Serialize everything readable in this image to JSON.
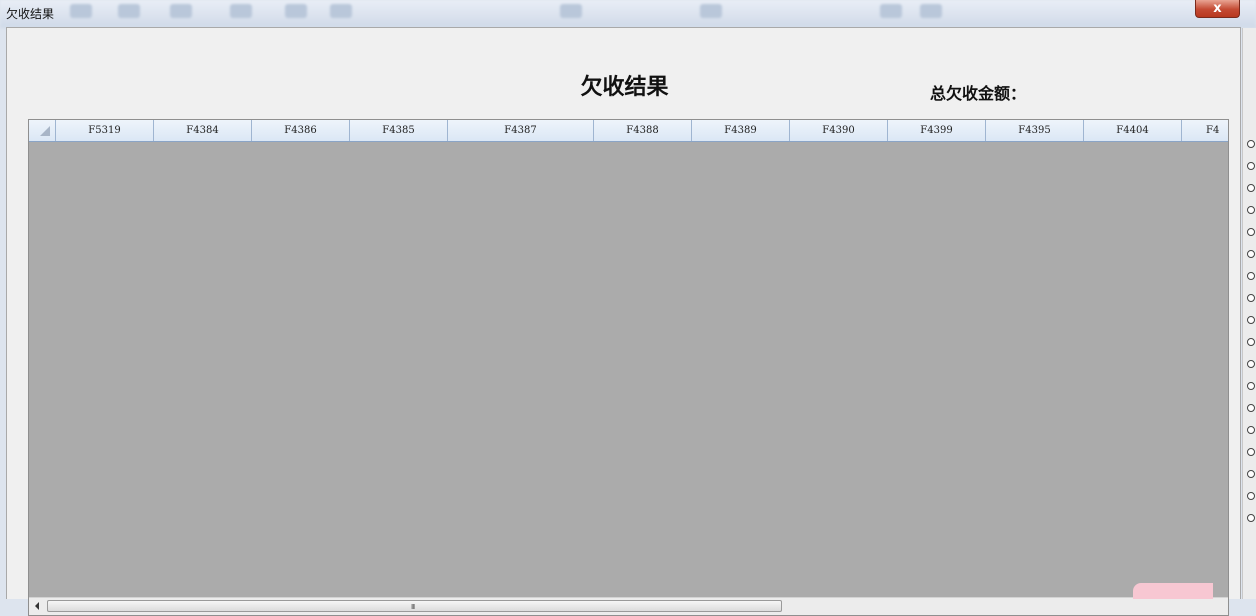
{
  "window": {
    "title": "欠收结果",
    "close_label": "x"
  },
  "report": {
    "title": "欠收结果",
    "total_label": "总欠收金额："
  },
  "grid": {
    "columns": [
      "F5319",
      "F4384",
      "F4386",
      "F4385",
      "F4387",
      "F4388",
      "F4389",
      "F4390",
      "F4399",
      "F4395",
      "F4404",
      "F4"
    ],
    "rows": []
  },
  "scrollbar": {
    "grip_glyph": "III"
  }
}
